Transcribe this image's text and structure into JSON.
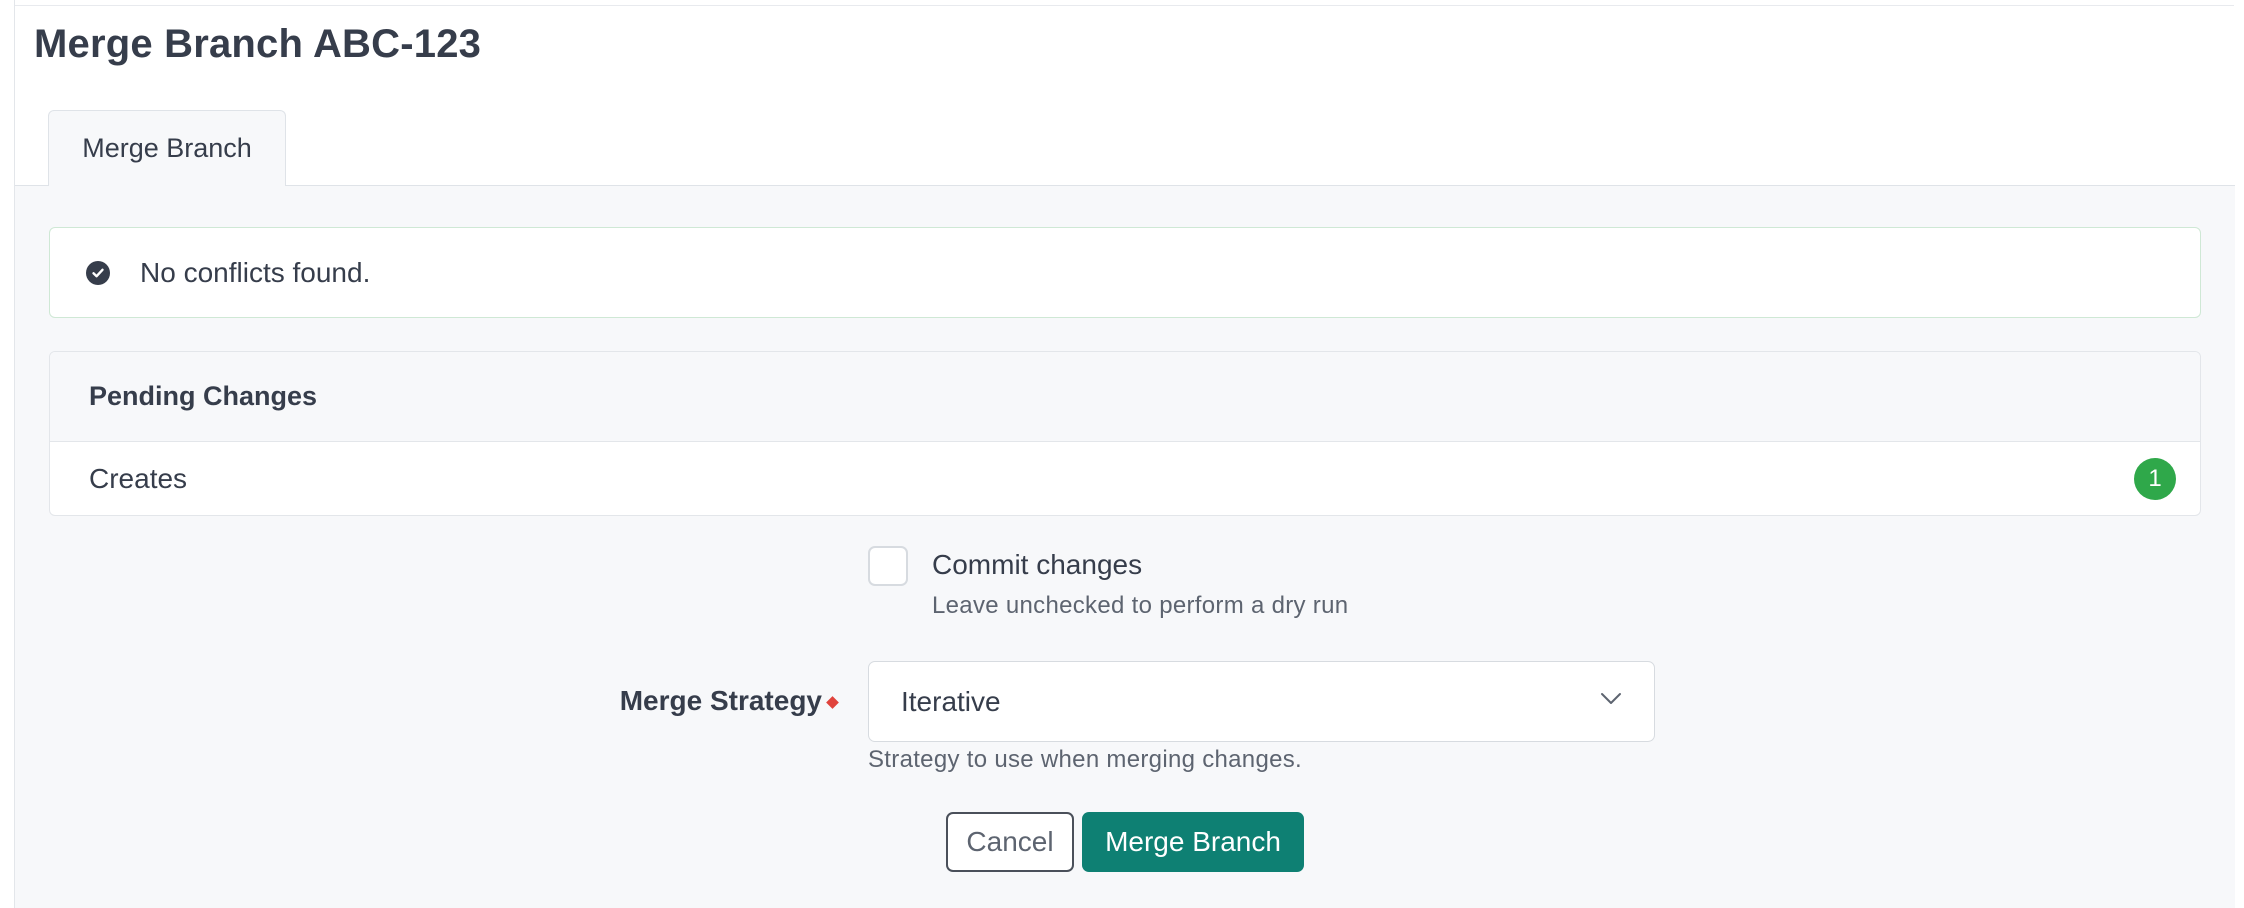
{
  "page": {
    "title": "Merge Branch ABC-123"
  },
  "tabs": [
    {
      "label": "Merge Branch",
      "active": true
    }
  ],
  "alert": {
    "text": "No conflicts found.",
    "icon": "check-circle-icon"
  },
  "pending_changes": {
    "heading": "Pending Changes",
    "rows": [
      {
        "label": "Creates",
        "count": "1"
      }
    ]
  },
  "form": {
    "commit": {
      "label": "Commit changes",
      "help": "Leave unchecked to perform a dry run",
      "checked": false
    },
    "strategy": {
      "label": "Merge Strategy",
      "value": "Iterative",
      "help": "Strategy to use when merging changes.",
      "required": true
    },
    "cancel_label": "Cancel",
    "submit_label": "Merge Branch"
  },
  "colors": {
    "primary": "#0e8073",
    "success_badge": "#2fa84a",
    "required": "#e0433c",
    "text": "#363d4b"
  }
}
